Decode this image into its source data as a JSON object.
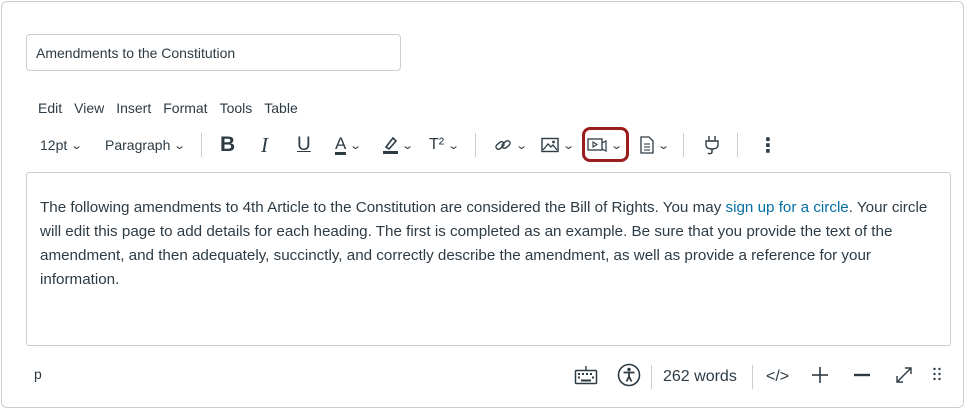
{
  "title_field": {
    "value": "Amendments to the Constitution"
  },
  "menubar": {
    "edit": "Edit",
    "view": "View",
    "insert": "Insert",
    "format": "Format",
    "tools": "Tools",
    "table": "Table"
  },
  "toolbar": {
    "font_size": "12pt",
    "block_format": "Paragraph",
    "bold_label": "B",
    "italic_label": "I",
    "underline_label": "U",
    "text_color_label": "A",
    "superscript_label": "T²",
    "more_label": "⋮",
    "text_color_hex": "#2d3b45",
    "icons": [
      "link-icon",
      "image-icon",
      "media-icon",
      "document-icon",
      "apps-plug-icon"
    ]
  },
  "editor": {
    "text_before_link": "The following amendments to 4th Article to the Constitution are considered the Bill of Rights. You may ",
    "link_text": "sign up for a circle",
    "text_after_link": ". Your circle will edit this page to add details for each heading. The first is completed as an example. Be sure that you provide the text of the amendment, and then adequately, succinctly, and correctly describe the amendment, as well as provide a reference for your information."
  },
  "statusbar": {
    "element_path": "p",
    "word_count": "262 words",
    "html_toggle": "</>"
  },
  "colors": {
    "highlight": "#9b1c1c",
    "link": "#0770a3",
    "border": "#c7cdd1",
    "text": "#2d3b45"
  }
}
